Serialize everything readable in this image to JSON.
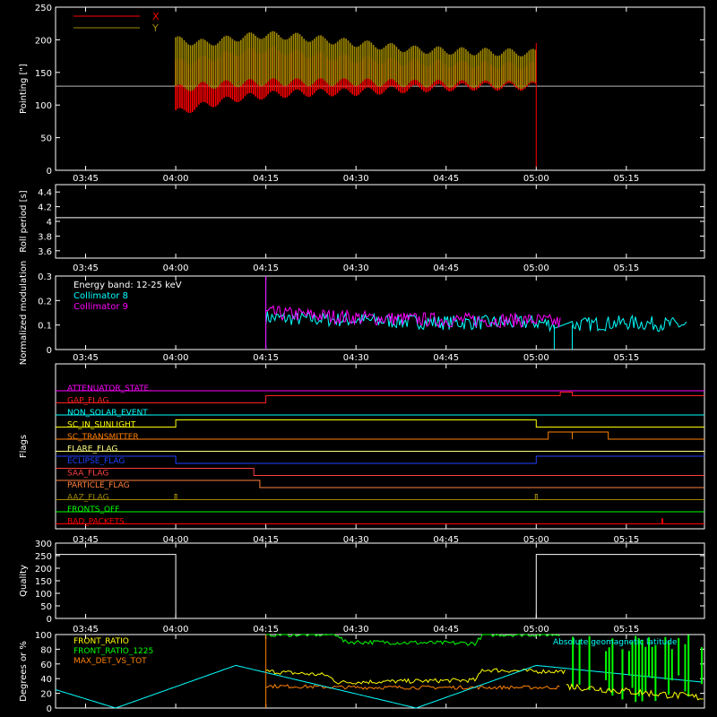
{
  "figure": {
    "background": "#000000",
    "axis_color": "#ffffff"
  },
  "time_ticks": [
    "03:45",
    "04:00",
    "04:15",
    "04:30",
    "04:45",
    "05:00",
    "05:15"
  ],
  "chart_data": [
    {
      "id": "pointing",
      "type": "line",
      "ylabel": "Pointing [\"]",
      "ylim": [
        0,
        250
      ],
      "yticks": [
        0,
        50,
        100,
        150,
        200,
        250
      ],
      "xlim": [
        "03:40",
        "05:28"
      ],
      "legend": {
        "placement": "top-left",
        "entries": [
          {
            "name": "X",
            "color": "#ff0000"
          },
          {
            "name": "Y",
            "color": "#a08a00"
          }
        ]
      },
      "series": [
        {
          "name": "X",
          "color": "#ff0000",
          "x": [
            "04:00",
            "04:05",
            "04:10",
            "04:15",
            "04:20",
            "04:30",
            "04:40",
            "04:50",
            "05:00"
          ],
          "y_min": [
            88,
            100,
            110,
            115,
            118,
            120,
            125,
            128,
            128
          ],
          "y_max": [
            165,
            170,
            180,
            185,
            180,
            170,
            165,
            162,
            160
          ]
        },
        {
          "name": "Y",
          "color": "#a08a00",
          "x": [
            "04:00",
            "04:05",
            "04:10",
            "04:15",
            "04:20",
            "04:30",
            "04:40",
            "04:50",
            "05:00"
          ],
          "y_min": [
            125,
            130,
            133,
            135,
            135,
            135,
            133,
            132,
            130
          ],
          "y_max": [
            200,
            195,
            203,
            208,
            205,
            195,
            185,
            182,
            180
          ]
        }
      ],
      "reference_line": 129
    },
    {
      "id": "roll",
      "type": "line",
      "ylabel": "Roll period [s]",
      "ylim": [
        3.5,
        4.5
      ],
      "yticks": [
        3.6,
        3.8,
        4.0,
        4.2,
        4.4
      ],
      "series": [
        {
          "name": "roll",
          "color": "#ffffff",
          "x": [
            "03:40",
            "05:28"
          ],
          "y": [
            4.05,
            4.05
          ]
        }
      ]
    },
    {
      "id": "modulation",
      "type": "line",
      "ylabel": "Normalized modulation",
      "ylim": [
        0,
        0.3
      ],
      "yticks": [
        0.0,
        0.1,
        0.2,
        0.3
      ],
      "annotations": [
        "Energy band: 12-25 keV"
      ],
      "legend": {
        "placement": "top-left",
        "entries": [
          {
            "name": "Collimator 8",
            "color": "#00ffff"
          },
          {
            "name": "Collimator 9",
            "color": "#ff00ff"
          }
        ]
      },
      "series": [
        {
          "name": "Collimator 8",
          "color": "#00ffff",
          "x": [
            "04:15",
            "04:30",
            "04:45",
            "05:00",
            "05:05",
            "05:15",
            "05:25"
          ],
          "y": [
            0.13,
            0.12,
            0.11,
            0.11,
            0.1,
            0.11,
            0.1
          ]
        },
        {
          "name": "Collimator 9",
          "color": "#ff00ff",
          "x": [
            "04:15",
            "04:30",
            "04:45",
            "05:00",
            "05:04"
          ],
          "y": [
            0.15,
            0.13,
            0.12,
            0.12,
            0.11
          ]
        }
      ]
    },
    {
      "id": "flags",
      "type": "line",
      "ylabel": "Flags",
      "flags": [
        {
          "label": "ATTENUATOR_STATE",
          "color": "#ff00ff",
          "changes": []
        },
        {
          "label": "GAP_FLAG",
          "color": "#ff2020",
          "changes": [
            [
              "03:40",
              0
            ],
            [
              "04:15",
              1
            ],
            [
              "05:04",
              1.5
            ],
            [
              "05:06",
              1
            ]
          ]
        },
        {
          "label": "NON_SOLAR_EVENT",
          "color": "#00ffff",
          "changes": []
        },
        {
          "label": "SC_IN_SUNLIGHT",
          "color": "#ffff00",
          "changes": [
            [
              "03:40",
              0
            ],
            [
              "04:00",
              1
            ],
            [
              "05:00",
              0
            ]
          ]
        },
        {
          "label": "SC_TRANSMITTER",
          "color": "#ff8000",
          "changes": [
            [
              "03:40",
              0
            ],
            [
              "05:02",
              1
            ],
            [
              "05:06",
              0
            ],
            [
              "05:06",
              1
            ],
            [
              "05:12",
              0
            ]
          ]
        },
        {
          "label": "FLARE_FLAG",
          "color": "#ffff80",
          "changes": []
        },
        {
          "label": "ECLIPSE_FLAG",
          "color": "#2040ff",
          "changes": [
            [
              "03:40",
              1
            ],
            [
              "04:00",
              0
            ],
            [
              "05:00",
              1
            ]
          ]
        },
        {
          "label": "SAA_FLAG",
          "color": "#ff4040",
          "changes": [
            [
              "03:40",
              1
            ],
            [
              "04:13",
              0
            ]
          ]
        },
        {
          "label": "PARTICLE_FLAG",
          "color": "#ff8040",
          "changes": [
            [
              "03:40",
              1
            ],
            [
              "04:14",
              0
            ]
          ]
        },
        {
          "label": "AAZ_FLAG",
          "color": "#a08a00",
          "changes": []
        },
        {
          "label": "FRONTS_OFF",
          "color": "#00ff00",
          "changes": []
        },
        {
          "label": "BAD_PACKETS",
          "color": "#ff0000",
          "changes": []
        }
      ]
    },
    {
      "id": "quality",
      "type": "line",
      "ylabel": "Quality",
      "ylim": [
        0,
        300
      ],
      "yticks": [
        0,
        50,
        100,
        150,
        200,
        250,
        300
      ],
      "series": [
        {
          "name": "quality",
          "color": "#ffffff",
          "x": [
            "03:40",
            "04:00",
            "04:00",
            "05:00",
            "05:00",
            "05:28"
          ],
          "y": [
            255,
            255,
            0,
            0,
            255,
            255
          ]
        }
      ]
    },
    {
      "id": "ratios",
      "type": "line",
      "ylabel": "Degrees or %",
      "ylim": [
        0,
        100
      ],
      "yticks": [
        0,
        20,
        40,
        60,
        80,
        100
      ],
      "legend": {
        "placement": "top-left",
        "entries": [
          {
            "name": "FRONT_RATIO",
            "color": "#ffff00"
          },
          {
            "name": "FRONT_RATIO_1225",
            "color": "#00ff00"
          },
          {
            "name": "MAX_DET_VS_TOT",
            "color": "#ff8000"
          }
        ]
      },
      "annotations": [
        "Absolute geomagnetic latitude"
      ],
      "series": [
        {
          "name": "FRONT_RATIO",
          "color": "#ffff00",
          "x": [
            "04:15",
            "04:25",
            "04:27",
            "04:50",
            "04:51",
            "05:00",
            "05:05"
          ],
          "y": [
            50,
            45,
            35,
            38,
            52,
            50,
            50
          ]
        },
        {
          "name": "FRONT_RATIO_1225",
          "color": "#00ff00",
          "x": [
            "04:15",
            "04:27",
            "04:28",
            "04:50",
            "04:51",
            "05:04"
          ],
          "y": [
            100,
            100,
            90,
            88,
            100,
            100
          ]
        },
        {
          "name": "MAX_DET_VS_TOT",
          "color": "#ff8000",
          "x": [
            "04:15",
            "04:30",
            "04:45",
            "05:00",
            "05:04"
          ],
          "y": [
            30,
            28,
            28,
            28,
            28
          ]
        },
        {
          "name": "Absolute geomagnetic latitude",
          "color": "#00ffff",
          "x": [
            "03:40",
            "03:50",
            "04:10",
            "04:40",
            "05:00",
            "05:28"
          ],
          "y": [
            25,
            0,
            58,
            0,
            58,
            35
          ]
        }
      ]
    }
  ]
}
